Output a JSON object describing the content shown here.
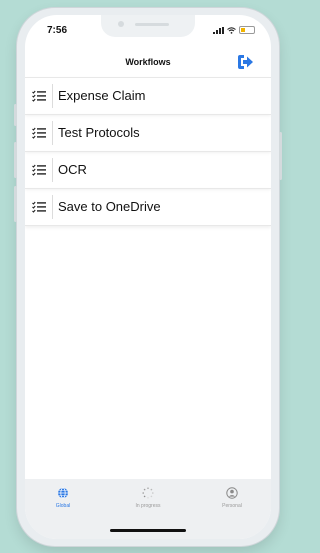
{
  "status_bar": {
    "time": "7:56"
  },
  "nav": {
    "title": "Workflows",
    "logout_icon": "logout-icon"
  },
  "workflows": [
    {
      "label": "Expense Claim",
      "icon": "list-icon"
    },
    {
      "label": "Test Protocols",
      "icon": "list-icon"
    },
    {
      "label": "OCR",
      "icon": "list-icon"
    },
    {
      "label": "Save to OneDrive",
      "icon": "list-icon"
    }
  ],
  "tabs": [
    {
      "label": "Global",
      "icon": "globe-icon",
      "active": true
    },
    {
      "label": "In progress",
      "icon": "spinner-icon",
      "active": false
    },
    {
      "label": "Personal",
      "icon": "person-icon",
      "active": false
    }
  ],
  "colors": {
    "accent": "#2b78e4",
    "background": "#b4dcd4"
  }
}
